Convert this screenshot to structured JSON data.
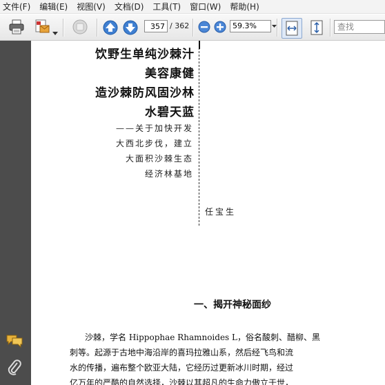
{
  "menu": [
    "文件(F)",
    "编辑(E)",
    "视图(V)",
    "文档(D)",
    "工具(T)",
    "窗口(W)",
    "帮助(H)"
  ],
  "toolbar": {
    "icons": [
      "print-icon",
      "email-icon",
      "chevron-down-icon",
      "hand-icon",
      "up-arrow-icon",
      "down-arrow-icon",
      "zoom-out-icon",
      "zoom-in-icon",
      "fit-width-icon",
      "fit-page-icon"
    ],
    "current_page": "357",
    "total_pages": "/ 362",
    "zoom": "59.3%",
    "search_placeholder": "查找"
  },
  "sidebar": {
    "icons": [
      "comment-icon",
      "attachment-icon"
    ]
  },
  "document": {
    "title_lines": [
      "饮野生单纯沙棘汁",
      "美容康健",
      "造沙棘防风固沙林",
      "水碧天蓝"
    ],
    "subtitle_lines": [
      "——关于加快开发",
      "大西北步伐，建立",
      "大面积沙棘生态",
      "经济林基地"
    ],
    "author": "任宝生",
    "section_heading": "一、揭开神秘面纱",
    "paragraph_lines": [
      "沙棘，学名 Hippophae Rhamnoides L，俗名酸刺、醋柳、黑",
      "刺等。起源于古地中海沿岸的喜玛拉雅山系，然后经飞鸟和流",
      "水的传播，遍布整个欧亚大陆，它经历过更新冰川时期，经过",
      "亿万年的严酷的自然选择，沙棘以其超凡的生命力傲立于世，"
    ]
  }
}
